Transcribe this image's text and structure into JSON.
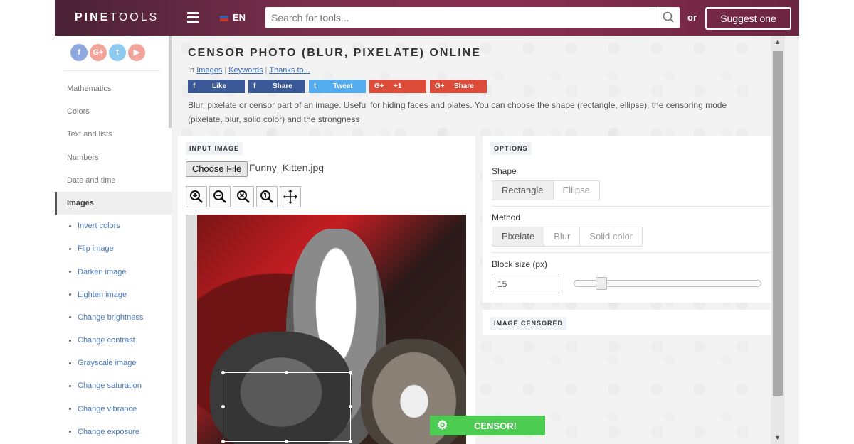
{
  "header": {
    "logo_bold": "PINE",
    "logo_thin": "TOOLS",
    "lang": "EN",
    "search_placeholder": "Search for tools...",
    "or": "or",
    "suggest": "Suggest one"
  },
  "sidebar": {
    "social": [
      "f",
      "G+",
      "t",
      "▶"
    ],
    "social_colors": [
      "#8fa9e0",
      "#f2a39a",
      "#8ec9ef",
      "#f2a39a"
    ],
    "categories": [
      "Mathematics",
      "Colors",
      "Text and lists",
      "Numbers",
      "Date and time",
      "Images"
    ],
    "active_category": "Images",
    "subitems": [
      "Invert colors",
      "Flip image",
      "Darken image",
      "Lighten image",
      "Change brightness",
      "Change contrast",
      "Grayscale image",
      "Change saturation",
      "Change vibrance",
      "Change exposure"
    ]
  },
  "main": {
    "title": "CENSOR PHOTO (BLUR, PIXELATE) ONLINE",
    "crumbs": {
      "prefix": "In",
      "links": [
        "Images",
        "Keywords",
        "Thanks to..."
      ]
    },
    "share": [
      {
        "icon": "f",
        "label": "Like",
        "color": "#3b5998"
      },
      {
        "icon": "f",
        "label": "Share",
        "color": "#3b5998"
      },
      {
        "icon": "t",
        "label": "Tweet",
        "color": "#55acee"
      },
      {
        "icon": "G+",
        "label": "+1",
        "color": "#dd4b39"
      },
      {
        "icon": "G+",
        "label": "Share",
        "color": "#dd4b39"
      }
    ],
    "description": "Blur, pixelate or censor part of an image. Useful for hiding faces and plates. You can choose the shape (rectangle, ellipse), the censoring mode (pixelate, blur, solid color) and the strongness"
  },
  "input": {
    "tag": "INPUT IMAGE",
    "choose_file": "Choose File",
    "filename": "Funny_Kitten.jpg",
    "tools": [
      "zoom-in",
      "zoom-out",
      "zoom-reset",
      "zoom-fit",
      "move"
    ]
  },
  "options": {
    "tag": "OPTIONS",
    "shape_label": "Shape",
    "shapes": [
      "Rectangle",
      "Ellipse"
    ],
    "shape_selected": "Rectangle",
    "method_label": "Method",
    "methods": [
      "Pixelate",
      "Blur",
      "Solid color"
    ],
    "method_selected": "Pixelate",
    "block_label": "Block size (px)",
    "block_value": "15",
    "block_slider_fraction": 0.12
  },
  "result": {
    "tag": "IMAGE CENSORED"
  },
  "censor_button": "CENSOR!"
}
